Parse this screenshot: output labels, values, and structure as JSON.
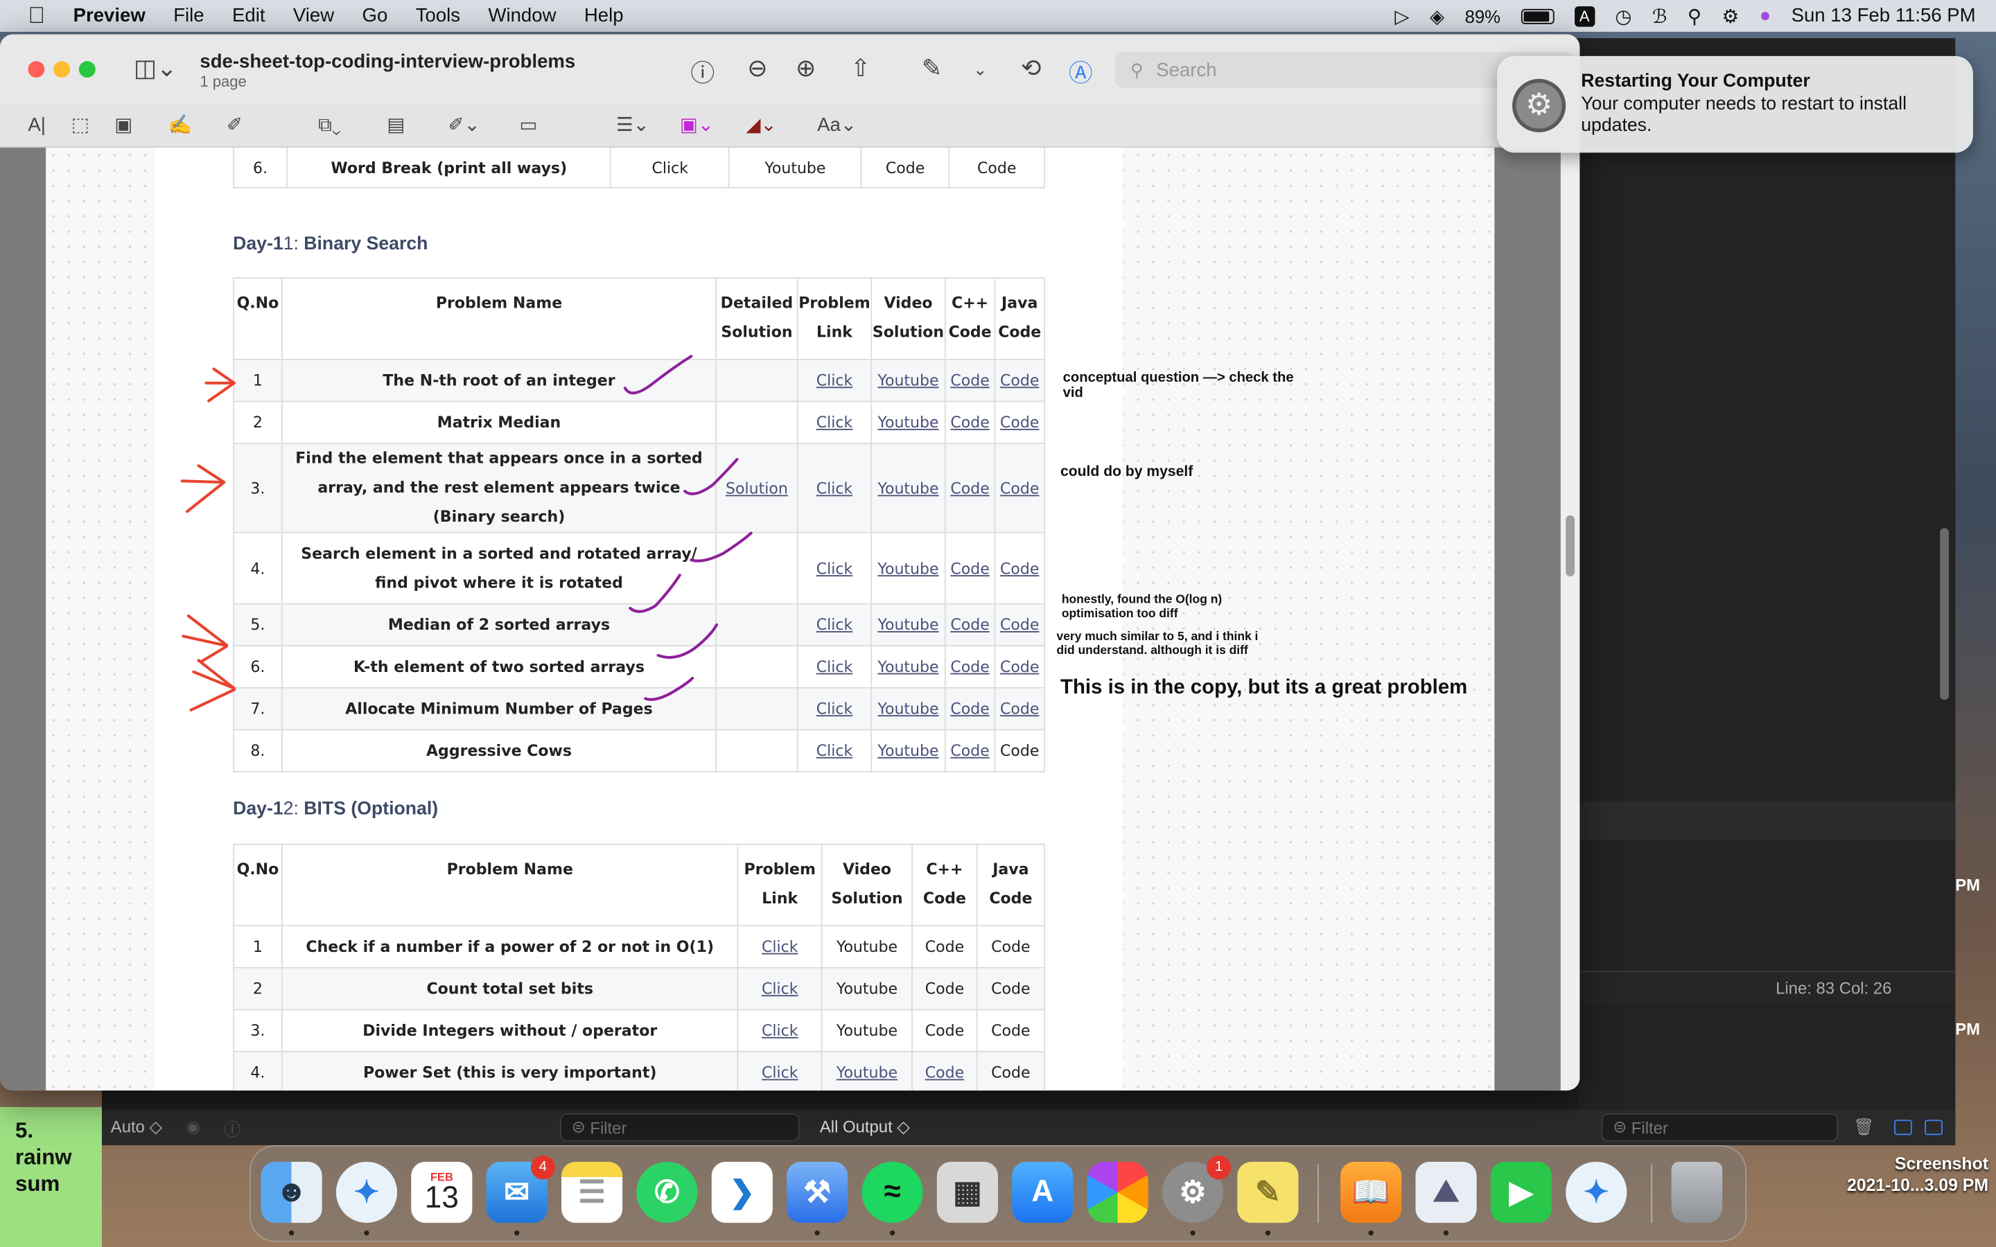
{
  "menubar": {
    "app": "Preview",
    "menus": [
      "File",
      "Edit",
      "View",
      "Go",
      "Tools",
      "Window",
      "Help"
    ],
    "battery": "89%",
    "input_source": "A",
    "datetime": "Sun 13 Feb  11:56 PM"
  },
  "window": {
    "title": "sde-sheet-top-coding-interview-problems",
    "subtitle": "1 page",
    "search_placeholder": "Search",
    "font_menu": "Aa"
  },
  "document": {
    "top_row": {
      "no": "6.",
      "name": "Word Break (print all ways)",
      "link": "Click",
      "video": "Youtube",
      "cpp": "Code",
      "java": "Code"
    },
    "day11": {
      "prefix": "Day-1",
      "suffix": "1: ",
      "title": "Binary Search",
      "headers": [
        "Q.No",
        "Problem Name",
        "Detailed Solution",
        "Problem Link",
        "Video Solution",
        "C++ Code",
        "Java Code"
      ],
      "rows": [
        {
          "no": "1",
          "name": "The N-th root of an integer",
          "sol": "",
          "link": "Click",
          "video": "Youtube",
          "cpp": "Code",
          "java": "Code"
        },
        {
          "no": "2",
          "name": "Matrix Median",
          "sol": "",
          "link": "Click",
          "video": "Youtube",
          "cpp": "Code",
          "java": "Code"
        },
        {
          "no": "3.",
          "name": "Find the element that appears once in a sorted array, and the rest element appears twice (Binary search)",
          "sol": "Solution",
          "link": "Click",
          "video": "Youtube",
          "cpp": "Code",
          "java": "Code"
        },
        {
          "no": "4.",
          "name": "Search element in a sorted and rotated array/ find pivot where it is rotated",
          "sol": "",
          "link": "Click",
          "video": "Youtube",
          "cpp": "Code",
          "java": "Code"
        },
        {
          "no": "5.",
          "name": "Median of 2 sorted arrays",
          "sol": "",
          "link": "Click",
          "video": "Youtube",
          "cpp": "Code",
          "java": "Code"
        },
        {
          "no": "6.",
          "name": "K-th element of two sorted arrays",
          "sol": "",
          "link": "Click",
          "video": "Youtube",
          "cpp": "Code",
          "java": "Code"
        },
        {
          "no": "7.",
          "name": "Allocate Minimum Number of Pages",
          "sol": "",
          "link": "Click",
          "video": "Youtube",
          "cpp": "Code",
          "java": "Code"
        },
        {
          "no": "8.",
          "name": "Aggressive Cows",
          "sol": "",
          "link": "Click",
          "video": "Youtube",
          "cpp": "Code",
          "java": "Code"
        }
      ]
    },
    "day12": {
      "prefix": "Day-1",
      "suffix": "2: ",
      "title": "BITS (Optional)",
      "headers": [
        "Q.No",
        "Problem Name",
        "Problem Link",
        "Video Solution",
        "C++ Code",
        "Java Code"
      ],
      "rows": [
        {
          "no": "1",
          "name": "Check if a number if a power of 2 or not in O(1)",
          "link": "Click",
          "video": "Youtube",
          "cpp": "Code",
          "java": "Code"
        },
        {
          "no": "2",
          "name": "Count total set bits",
          "link": "Click",
          "video": "Youtube",
          "cpp": "Code",
          "java": "Code"
        },
        {
          "no": "3.",
          "name": "Divide Integers without / operator",
          "link": "Click",
          "video": "Youtube",
          "cpp": "Code",
          "java": "Code"
        },
        {
          "no": "4.",
          "name": "Power Set (this is very important)",
          "link": "Click",
          "video": "Youtube",
          "cpp": "Code",
          "java": "Code"
        }
      ]
    },
    "notes": {
      "n1": "conceptual question —> check the vid",
      "n2": "could do by myself",
      "n3": "honestly, found the O(log n) optimisation too diff",
      "n4": "very much similar to 5, and i think i did understand. although it is diff",
      "n5": "This is in the copy, but its a great problem"
    }
  },
  "notification": {
    "title": "Restarting Your Computer",
    "body": "Your computer needs to restart to install updates."
  },
  "xcode": {
    "status": "Line: 83  Col: 26",
    "auto": "Auto ◇",
    "filter": "Filter",
    "output": "All Output ◇",
    "filter2": "Filter",
    "pm1": "PM",
    "pm2": "PM"
  },
  "sticky": {
    "text": "5. rainw sum"
  },
  "dock": {
    "calendar_month": "FEB",
    "calendar_day": "13",
    "mail_badge": "4",
    "settings_badge": "1"
  },
  "screenshot_label": {
    "line1": "Screenshot",
    "line2": "2021-10...3.09 PM"
  }
}
